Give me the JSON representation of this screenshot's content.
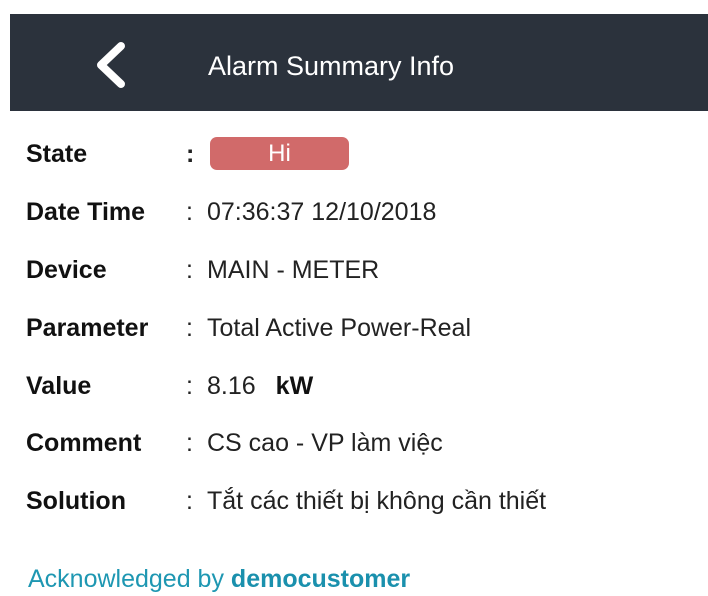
{
  "header": {
    "title": "Alarm Summary Info",
    "back_icon": "chevron-left-icon",
    "background_color": "#2b323c"
  },
  "fields": {
    "state": {
      "label": "State",
      "value": "Hi",
      "badge_color": "#d16a6a"
    },
    "datetime": {
      "label": "Date Time",
      "value": "07:36:37 12/10/2018"
    },
    "device": {
      "label": "Device",
      "value": "MAIN - METER"
    },
    "parameter": {
      "label": "Parameter",
      "value": "Total Active Power-Real"
    },
    "value": {
      "label": "Value",
      "value": "8.16",
      "unit": "kW"
    },
    "comment": {
      "label": "Comment",
      "value": "CS cao - VP làm việc"
    },
    "solution": {
      "label": "Solution",
      "value": "Tắt các thiết bị không cần thiết"
    }
  },
  "separator": ":",
  "acknowledgement": {
    "prefix": "Acknowledged by",
    "user": "democustomer",
    "color": "#1e97b2"
  }
}
